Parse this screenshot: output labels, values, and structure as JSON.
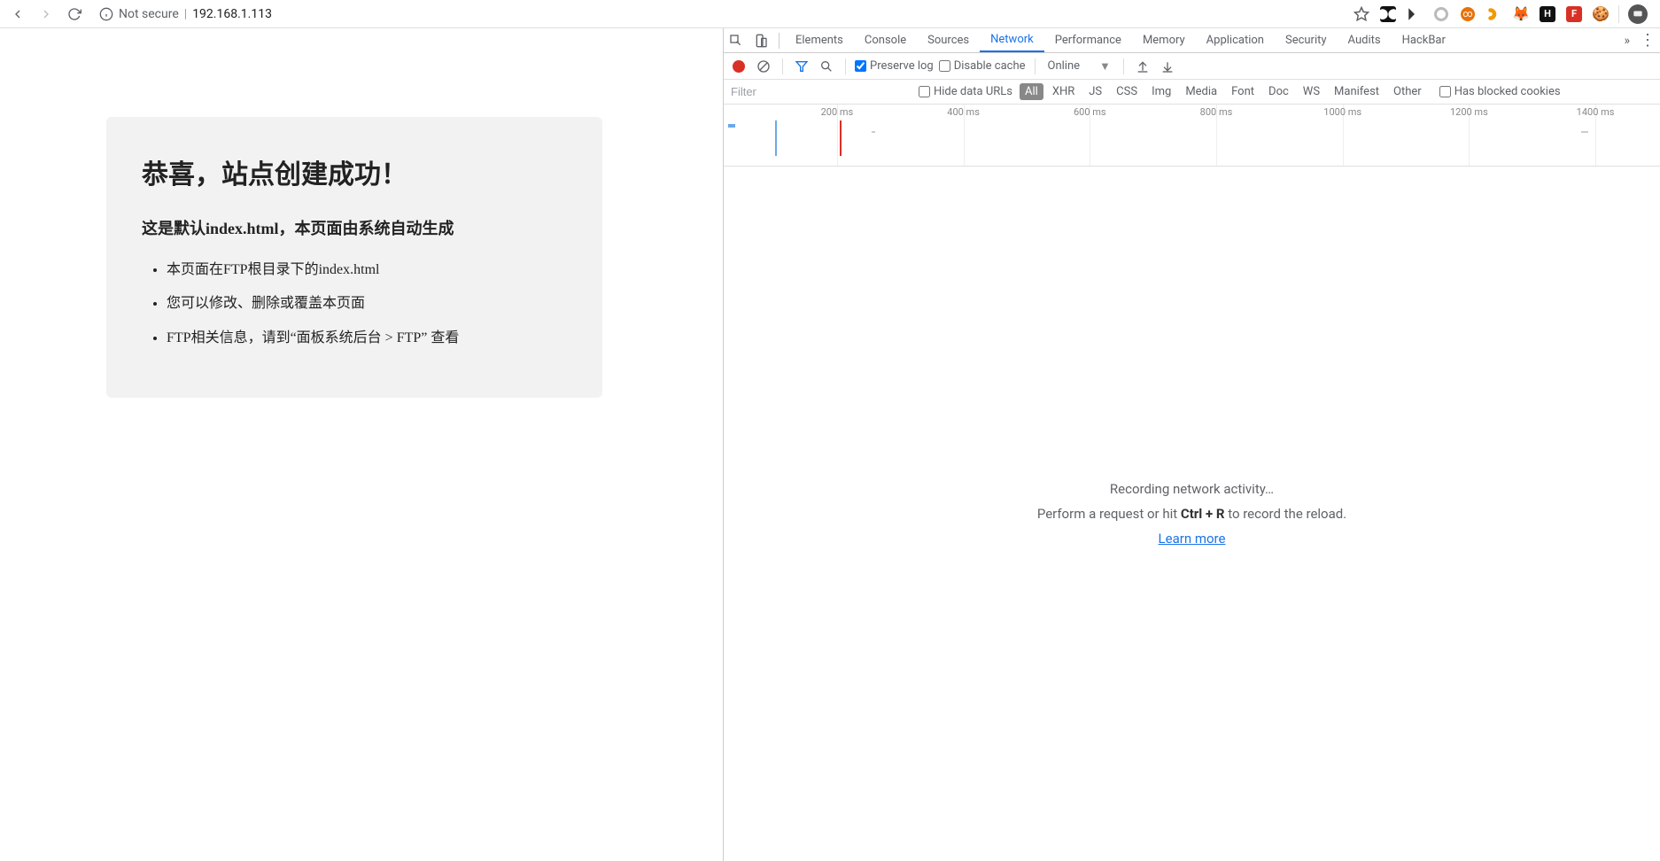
{
  "browser": {
    "security_label": "Not secure",
    "url": "192.168.1.113"
  },
  "page": {
    "title": "恭喜，站点创建成功！",
    "subtitle": "这是默认index.html，本页面由系统自动生成",
    "items": [
      "本页面在FTP根目录下的index.html",
      "您可以修改、删除或覆盖本页面",
      "FTP相关信息，请到“面板系统后台 > FTP” 查看"
    ]
  },
  "devtools": {
    "tabs": [
      "Elements",
      "Console",
      "Sources",
      "Network",
      "Performance",
      "Memory",
      "Application",
      "Security",
      "Audits",
      "HackBar"
    ],
    "active_tab": "Network",
    "net_toolbar": {
      "preserve_log": "Preserve log",
      "disable_cache": "Disable cache",
      "throttle": "Online"
    },
    "filter": {
      "placeholder": "Filter",
      "hide_data_urls": "Hide data URLs",
      "types": [
        "All",
        "XHR",
        "JS",
        "CSS",
        "Img",
        "Media",
        "Font",
        "Doc",
        "WS",
        "Manifest",
        "Other"
      ],
      "active_type": "All",
      "blocked_cookies": "Has blocked cookies"
    },
    "timeline": {
      "marks": [
        "200 ms",
        "400 ms",
        "600 ms",
        "800 ms",
        "1000 ms",
        "1200 ms",
        "1400 ms"
      ]
    },
    "empty": {
      "title": "Recording network activity…",
      "prefix": "Perform a request or hit ",
      "shortcut": "Ctrl + R",
      "suffix": " to record the reload.",
      "learn_more": "Learn more"
    }
  }
}
